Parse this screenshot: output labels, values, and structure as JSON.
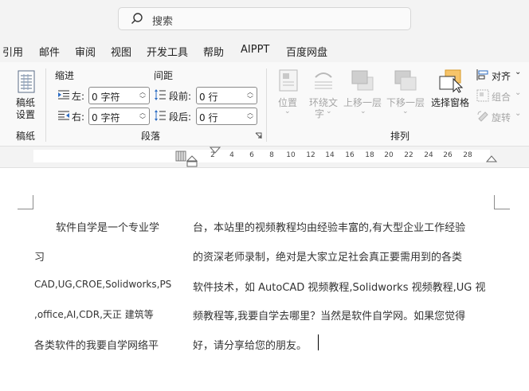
{
  "search": {
    "placeholder": "搜索"
  },
  "menu": {
    "tabs": [
      "引用",
      "邮件",
      "审阅",
      "视图",
      "开发工具",
      "帮助",
      "AIPPT",
      "百度网盘"
    ]
  },
  "ribbon": {
    "page_setup": {
      "button_label_1": "稿纸",
      "button_label_2": "设置",
      "group_label": "稿纸"
    },
    "paragraph": {
      "indent_header": "缩进",
      "spacing_header": "间距",
      "indent_left_label": "左:",
      "indent_left_value": "0 字符",
      "indent_right_label": "右:",
      "indent_right_value": "0 字符",
      "space_before_label": "段前:",
      "space_before_value": "0 行",
      "space_after_label": "段后:",
      "space_after_value": "0 行",
      "group_label": "段落"
    },
    "arrange": {
      "position_label": "位置",
      "wrap_text_label_1": "环绕文",
      "wrap_text_label_2": "字",
      "bring_forward_label": "上移一层",
      "send_backward_label": "下移一层",
      "selection_pane_label": "选择窗格",
      "align_label": "对齐",
      "group_label_btn": "组合",
      "rotate_label": "旋转",
      "group_label": "排列"
    }
  },
  "ruler": {
    "ticks": [
      "2",
      "4",
      "6",
      "8",
      "10",
      "12",
      "14",
      "16",
      "18",
      "20",
      "22",
      "24",
      "26",
      "28"
    ]
  },
  "document": {
    "left_column": [
      "软件自学是一个专业学",
      "习",
      "CAD,UG,CROE,Solidworks,PS",
      ",office,AI,CDR,天正  建筑等",
      "各类软件的我要自学网络平"
    ],
    "right_column": [
      "台，本站里的视频教程均由经验丰富的,有大型企业工作经验",
      "的资深老师录制，绝对是大家立足社会真正要需用到的各类",
      "软件技术，如 AutoCAD 视频教程,Solidworks 视频教程,UG 视",
      "频教程等,我要自学去哪里？当然是软件自学网。如果您觉得",
      "好，请分享给您的朋友。"
    ]
  }
}
